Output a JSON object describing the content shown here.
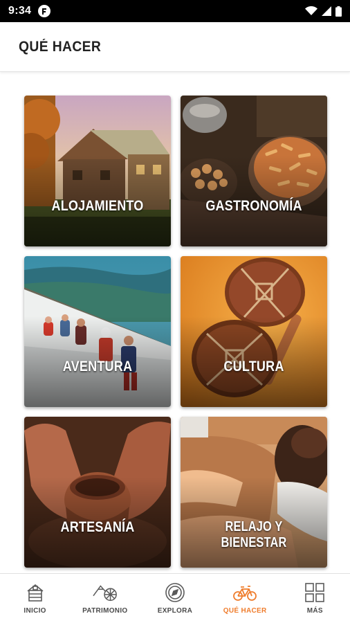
{
  "status_bar": {
    "time": "9:34"
  },
  "header": {
    "title": "QUÉ HACER"
  },
  "tiles": [
    {
      "label": "ALOJAMIENTO"
    },
    {
      "label": "GASTRONOMÍA"
    },
    {
      "label": "AVENTURA"
    },
    {
      "label": "CULTURA"
    },
    {
      "label": "ARTESANÍA"
    },
    {
      "label": "RELAJO Y BIENESTAR"
    }
  ],
  "bottom_nav": {
    "items": [
      {
        "label": "INICIO",
        "icon": "house-icon"
      },
      {
        "label": "PATRIMONIO",
        "icon": "mountain-wheel-icon"
      },
      {
        "label": "EXPLORA",
        "icon": "compass-icon"
      },
      {
        "label": "QUÉ HACER",
        "icon": "bicycle-icon"
      },
      {
        "label": "MÁS",
        "icon": "grid-icon"
      }
    ],
    "active_index": 3
  },
  "colors": {
    "accent": "#ef7d2d",
    "status_bar": "#000000",
    "title_text": "#222222"
  }
}
